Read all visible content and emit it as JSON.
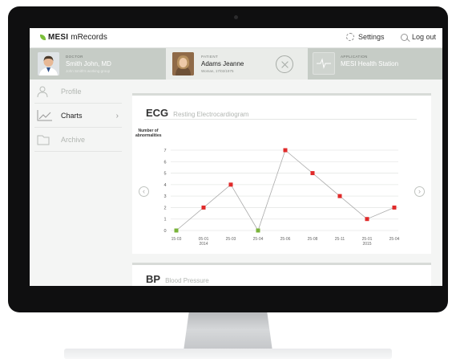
{
  "app": {
    "brand_bold": "MESI",
    "brand_rest": "mRecords",
    "settings_label": "Settings",
    "logout_label": "Log out"
  },
  "context": {
    "doctor": {
      "label": "DOCTOR",
      "name": "Smith John, MD",
      "sub": "John Smith's working group"
    },
    "patient": {
      "label": "PATIENT",
      "name": "Adams Jeanne",
      "sub": "Woman, 17/02/1975"
    },
    "application": {
      "label": "APPLICATION",
      "name": "MESI Health Station"
    }
  },
  "sidebar": {
    "items": [
      {
        "label": "Profile",
        "icon": "person-icon"
      },
      {
        "label": "Charts",
        "icon": "chart-icon"
      },
      {
        "label": "Archive",
        "icon": "folder-icon"
      }
    ]
  },
  "ecg_card": {
    "abbr": "ECG",
    "full": "Resting Electrocardiogram"
  },
  "bp_card": {
    "abbr": "BP",
    "full": "Blood Pressure"
  },
  "colors": {
    "accent_green": "#7bbf3a",
    "point_red": "#e02a2a",
    "point_green": "#79b33a",
    "line": "#aaaaaa"
  },
  "chart_data": {
    "type": "line",
    "title": "",
    "ylabel": "Number of abnormalities",
    "xlabel": "",
    "ylim": [
      0,
      7
    ],
    "yticks": [
      "0",
      "1",
      "2",
      "3",
      "4",
      "5",
      "6",
      "7"
    ],
    "categories": [
      "15-03",
      "05-01",
      "25-03",
      "25-04",
      "25-06",
      "25-08",
      "25-11",
      "25-01",
      "25-04"
    ],
    "year_labels": [
      "",
      "2014",
      "",
      "",
      "",
      "",
      "",
      "2015",
      ""
    ],
    "series": [
      {
        "values": [
          0,
          2,
          4,
          0,
          7,
          5,
          3,
          1,
          2
        ],
        "point_colors": [
          "green",
          "red",
          "red",
          "green",
          "red",
          "red",
          "red",
          "red",
          "red"
        ]
      }
    ]
  }
}
